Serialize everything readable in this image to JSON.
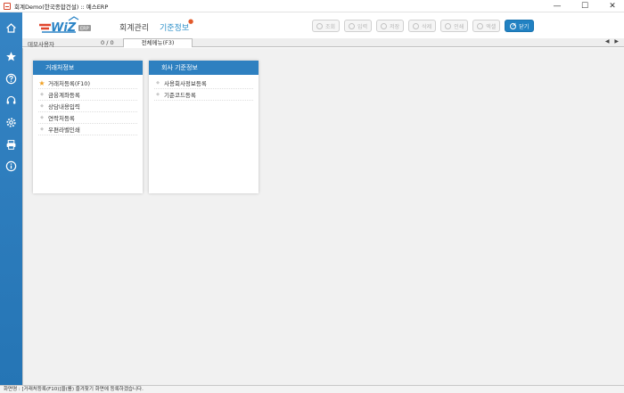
{
  "window": {
    "title": "회계Demo(한국종합건설) :: 예스ERP",
    "minimize": "—",
    "maximize": "☐",
    "close": "✕"
  },
  "sidebar": {
    "icons": [
      "home-icon",
      "star-icon",
      "help-icon",
      "headset-icon",
      "settings-icon",
      "printer-icon",
      "info-icon"
    ]
  },
  "header": {
    "logo_text": "WiZ",
    "logo_sub": "ERP",
    "nav": [
      "회계관리",
      "기준정보"
    ],
    "active_nav_index": 1,
    "new_marker": "●",
    "toolbar": [
      {
        "label": "조회",
        "enabled": false
      },
      {
        "label": "입력",
        "enabled": false
      },
      {
        "label": "저장",
        "enabled": false
      },
      {
        "label": "삭제",
        "enabled": false
      },
      {
        "label": "인쇄",
        "enabled": false
      },
      {
        "label": "엑셀",
        "enabled": false
      },
      {
        "label": "닫기",
        "enabled": true
      }
    ]
  },
  "tabstrip": {
    "user": "데모사용자",
    "count": "0 / 0",
    "active_tab": "전체메뉴(F3)",
    "arrows": "◀ ▶"
  },
  "panels": [
    {
      "title": "거래처정보",
      "items": [
        {
          "label": "거래처등록(F10)",
          "favorite": true
        },
        {
          "label": "금융계좌등록",
          "favorite": false
        },
        {
          "label": "상담내용입력",
          "favorite": false
        },
        {
          "label": "연락처등록",
          "favorite": false
        },
        {
          "label": "우편라벨인쇄",
          "favorite": false
        }
      ]
    },
    {
      "title": "회사 기준정보",
      "items": [
        {
          "label": "사용회사정보등록",
          "favorite": false
        },
        {
          "label": "기준코드등록",
          "favorite": false
        }
      ]
    }
  ],
  "status": {
    "text": "화면명 : [거래처등록(F10)]을(를) 즐겨찾기 화면에 등록하겠습니다."
  },
  "colors": {
    "sidebar": "#2a7bbb",
    "panel_header": "#2e80c0",
    "accent": "#2c8fc9",
    "close_button": "#2181c2"
  }
}
